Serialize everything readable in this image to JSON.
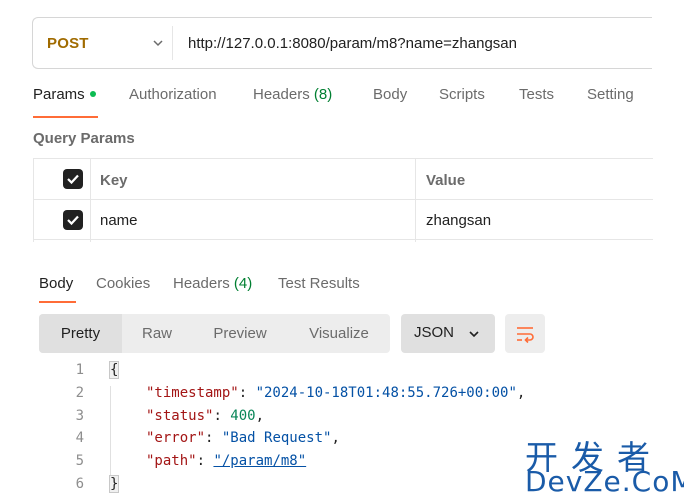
{
  "request": {
    "method": "POST",
    "url": "http://127.0.0.1:8080/param/m8?name=zhangsan"
  },
  "request_tabs": [
    {
      "label": "Params",
      "active": true,
      "indicator": true
    },
    {
      "label": "Authorization"
    },
    {
      "label": "Headers",
      "count": "(8)"
    },
    {
      "label": "Body"
    },
    {
      "label": "Scripts"
    },
    {
      "label": "Tests"
    },
    {
      "label": "Setting"
    }
  ],
  "query_params": {
    "title": "Query Params",
    "columns": [
      "Key",
      "Value"
    ],
    "rows": [
      {
        "checked": true,
        "key": "name",
        "value": "zhangsan"
      }
    ]
  },
  "response_tabs": [
    {
      "label": "Body",
      "active": true
    },
    {
      "label": "Cookies"
    },
    {
      "label": "Headers",
      "count": "(4)"
    },
    {
      "label": "Test Results"
    }
  ],
  "view_modes": [
    "Pretty",
    "Raw",
    "Preview",
    "Visualize"
  ],
  "active_view": "Pretty",
  "format": "JSON",
  "response_body": {
    "line_numbers": [
      "1",
      "2",
      "3",
      "4",
      "5",
      "6"
    ],
    "open_brace": "{",
    "close_brace": "}",
    "fields": [
      {
        "key": "\"timestamp\"",
        "value": "\"2024-10-18T01:48:55.726+00:00\"",
        "type": "string"
      },
      {
        "key": "\"status\"",
        "value": "400",
        "type": "number"
      },
      {
        "key": "\"error\"",
        "value": "\"Bad Request\"",
        "type": "string"
      },
      {
        "key": "\"path\"",
        "value": "\"/param/m8\"",
        "type": "link"
      }
    ]
  },
  "watermark": {
    "line1": "开发者",
    "line2": "DevZe.CoM"
  },
  "colors": {
    "accent": "#ff6c37",
    "method": "#a06b00",
    "count": "#007f31",
    "indicator": "#0cbb52"
  },
  "icons": [
    "chevron-down-icon",
    "checkbox-checked-icon",
    "wrap-lines-icon"
  ]
}
